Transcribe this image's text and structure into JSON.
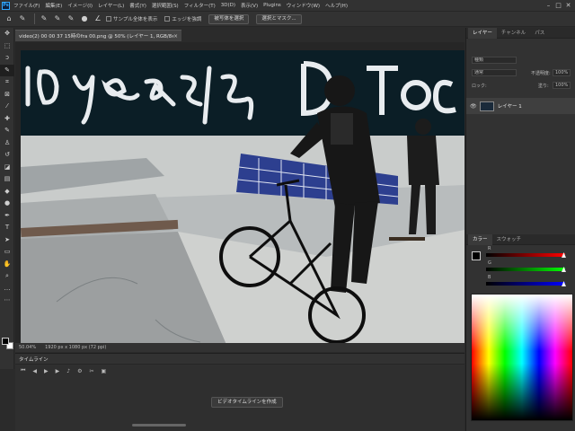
{
  "app": {
    "logo": "Ps",
    "menu": [
      "ファイル(F)",
      "編集(E)",
      "イメージ(I)",
      "レイヤー(L)",
      "書式(Y)",
      "選択範囲(S)",
      "フィルター(T)",
      "3D(D)",
      "表示(V)",
      "Plugins",
      "ウィンドウ(W)",
      "ヘルプ(H)"
    ],
    "window_controls": [
      "–",
      "□",
      "✕"
    ]
  },
  "options_bar": {
    "checkbox_1": "サンプル全体を表示",
    "checkbox_2": "エッジを強調",
    "button_1": "被写体を選択",
    "button_2": "選択とマスク..."
  },
  "document": {
    "tab_title": "video(2) 00 00 37 15時のfra 00.png @ 50% (レイヤー 1, RGB/8#) *",
    "close": "×",
    "zoom": "50.04%",
    "status": "1920 px x 1080 px (72 ppi)"
  },
  "timeline": {
    "title": "タイムライン",
    "create_button": "ビデオタイムラインを作成"
  },
  "layers_panel": {
    "tabs": [
      "レイヤー",
      "チャンネル",
      "パス"
    ],
    "kind_label": "種類",
    "blend_mode": "通常",
    "opacity_label": "不透明度:",
    "opacity_value": "100%",
    "lock_label": "ロック:",
    "fill_label": "塗り:",
    "fill_value": "100%",
    "layer_name": "レイヤー 1"
  },
  "color_panel": {
    "tabs": [
      "カラー",
      "スウォッチ"
    ],
    "channel_labels": [
      "R",
      "G",
      "B"
    ],
    "foreground": "#000000",
    "background": "#ffffff"
  },
  "canvas_text": {
    "graffiti": "10 years",
    "graffiti_right": "Do Toge"
  }
}
